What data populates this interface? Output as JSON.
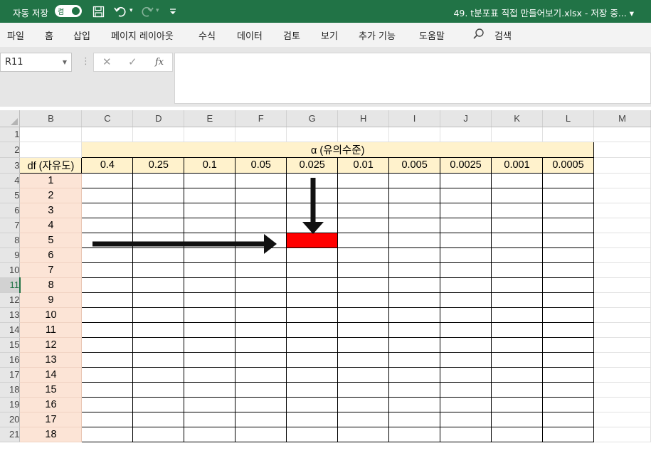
{
  "titlebar": {
    "autosave_label": "자동 저장",
    "autosave_state": "켬",
    "icons": [
      "save-icon",
      "undo-icon",
      "redo-icon",
      "customize-qat-icon"
    ],
    "doc_title": "49. t분포표 직접 만들어보기.xlsx - 저장 중... ▾",
    "bg_color": "#217346"
  },
  "menu": {
    "items": [
      "파일",
      "홈",
      "삽입",
      "페이지 레이아웃",
      "수식",
      "데이터",
      "검토",
      "보기",
      "추가 기능",
      "도움말"
    ],
    "search_label": "검색"
  },
  "formula_bar": {
    "name_box": "R11",
    "cancel_glyph": "✕",
    "enter_glyph": "✓",
    "fx_label": "fx",
    "formula": ""
  },
  "sheet": {
    "columns": [
      "B",
      "C",
      "D",
      "E",
      "F",
      "G",
      "H",
      "I",
      "J",
      "K",
      "L",
      "M"
    ],
    "rows": [
      "1",
      "2",
      "3",
      "4",
      "5",
      "6",
      "7",
      "8",
      "9",
      "10",
      "11",
      "12",
      "13",
      "14",
      "15",
      "16",
      "17",
      "18",
      "19",
      "20",
      "21"
    ],
    "selected_row": "11",
    "alpha_header": "α (유의수준)",
    "df_header": "df (자유도)",
    "alpha_values": [
      "0.4",
      "0.25",
      "0.1",
      "0.05",
      "0.025",
      "0.01",
      "0.005",
      "0.0025",
      "0.001",
      "0.0005"
    ],
    "df_values": [
      "1",
      "2",
      "3",
      "4",
      "5",
      "6",
      "7",
      "8",
      "9",
      "10",
      "11",
      "12",
      "13",
      "14",
      "15",
      "16",
      "17",
      "18"
    ],
    "highlight": {
      "df": "5",
      "alpha": "0.025",
      "color": "#ff0000"
    }
  }
}
